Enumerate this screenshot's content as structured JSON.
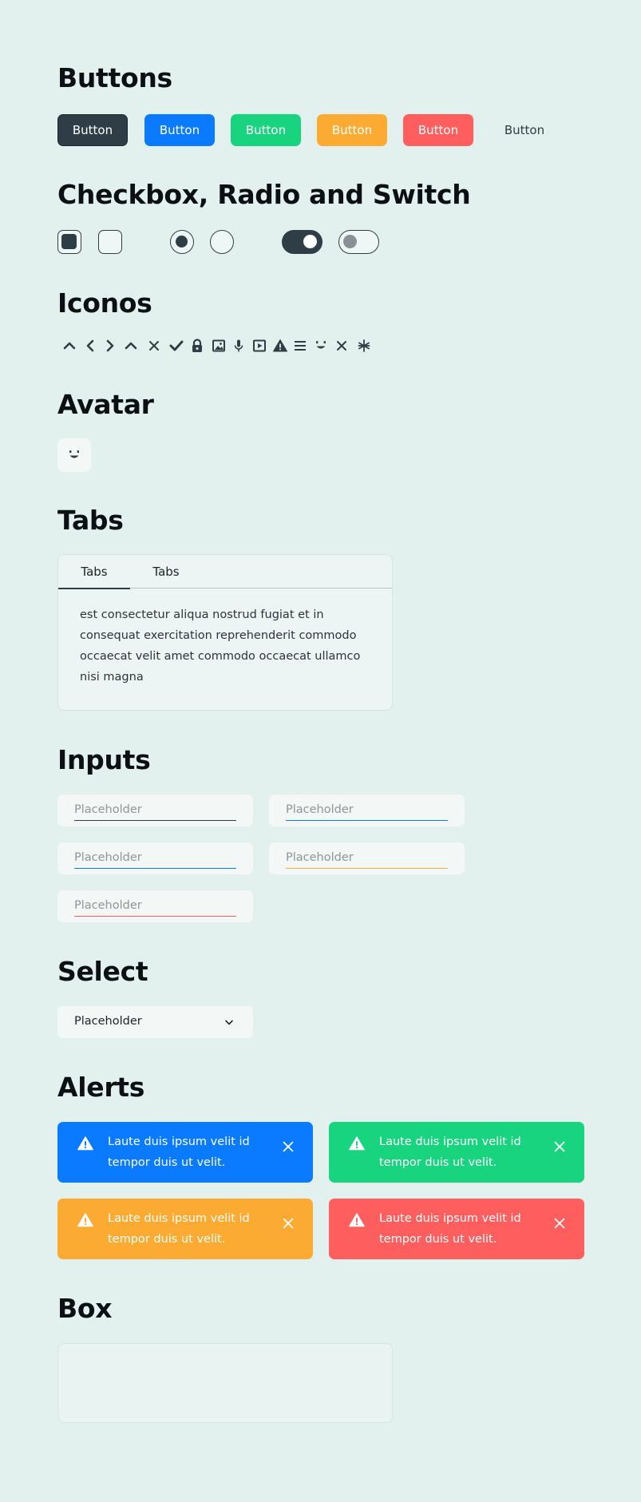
{
  "sections": {
    "buttons": "Buttons",
    "checks": "Checkbox, Radio and Switch",
    "icons": "Iconos",
    "avatar": "Avatar",
    "tabs": "Tabs",
    "inputs": "Inputs",
    "select": "Select",
    "alerts": "Alerts",
    "box": "Box"
  },
  "buttons": [
    {
      "label": "Button",
      "variant": "dark",
      "color": "#2f3e46"
    },
    {
      "label": "Button",
      "variant": "blue",
      "color": "#0a7bff"
    },
    {
      "label": "Button",
      "variant": "green",
      "color": "#19d47f"
    },
    {
      "label": "Button",
      "variant": "orange",
      "color": "#fbab32"
    },
    {
      "label": "Button",
      "variant": "red",
      "color": "#fe5e5e"
    },
    {
      "label": "Button",
      "variant": "plain",
      "color": "transparent"
    }
  ],
  "controls": {
    "checkbox_checked": true,
    "checkbox_unchecked": false,
    "radio_selected": true,
    "radio_unselected": false,
    "switch_on": true,
    "switch_off": false
  },
  "icons": [
    "chevron-up-icon",
    "chevron-left-icon",
    "chevron-right-icon",
    "chevron-up-icon",
    "close-icon",
    "check-icon",
    "lock-icon",
    "image-icon",
    "microphone-icon",
    "play-icon",
    "warning-icon",
    "menu-icon",
    "smile-icon",
    "close-icon",
    "asterisk-icon"
  ],
  "avatar": {
    "icon": "smile-icon"
  },
  "tabs": {
    "items": [
      {
        "label": "Tabs",
        "active": true
      },
      {
        "label": "Tabs",
        "active": false
      }
    ],
    "content": "est consectetur aliqua nostrud fugiat et in consequat exercitation reprehenderit commodo occaecat velit amet commodo occaecat ullamco nisi magna"
  },
  "inputs": [
    {
      "placeholder": "Placeholder",
      "value": "",
      "accent": "#2f3e46"
    },
    {
      "placeholder": "Placeholder",
      "value": "",
      "accent": "#0a7bff"
    },
    {
      "placeholder": "Placeholder",
      "value": "",
      "accent": "#0a7bff"
    },
    {
      "placeholder": "Placeholder",
      "value": "",
      "accent": "#fbab32"
    },
    {
      "placeholder": "Placeholder",
      "value": "",
      "accent": "#fe5e5e"
    }
  ],
  "select": {
    "value": "Placeholder"
  },
  "alerts": [
    {
      "text": "Laute duis ipsum velit id tempor duis ut velit.",
      "color": "#0a7bff"
    },
    {
      "text": "Laute duis ipsum velit id tempor duis ut velit.",
      "color": "#19d47f"
    },
    {
      "text": "Laute duis ipsum velit id tempor duis ut velit.",
      "color": "#fbab32"
    },
    {
      "text": "Laute duis ipsum velit id tempor duis ut velit.",
      "color": "#fe5e5e"
    }
  ]
}
